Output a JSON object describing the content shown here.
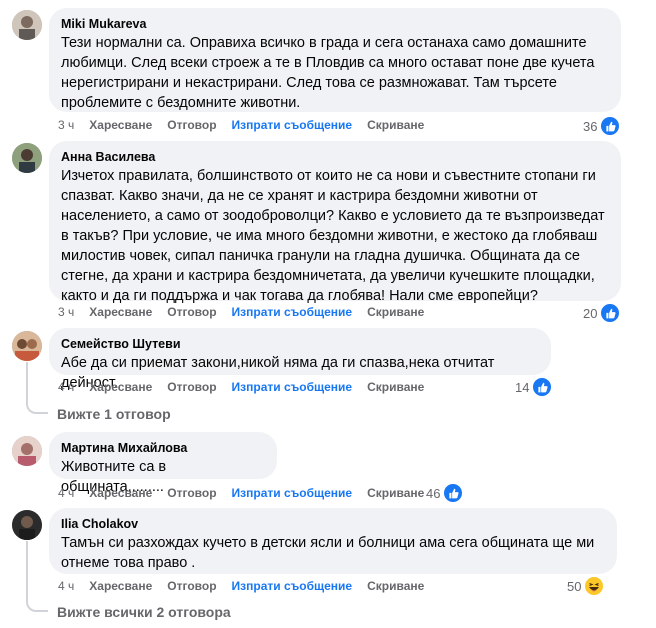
{
  "comments": [
    {
      "author": "Miki Mukareva",
      "text": "Тези нормални са. Оправиха всичко в града и сега останаха само домашните любимци. След всеки строеж а те в Пловдив са много остават поне две кучета нерегистрирани и некастрирани. След това се размножават. Там търсете проблемите с бездомните животни.",
      "time": "3 ч",
      "like": "Харесване",
      "reply": "Отговор",
      "send": "Изпрати съобщение",
      "hide": "Скриване",
      "reactions": "36",
      "reaction_icon": "like-icon"
    },
    {
      "author": "Анна Василева",
      "text": "Изчетох правилата, болшинството от които не са нови и съвестните стопани ги спазват. Какво значи, да не се хранят и кастрира бездомни животни от населението, а само от зоодоброволци? Какво е условието да те възпроизведат в такъв? При условие, че има много бездомни животни, е жестоко да глобяваш милостив човек, сипал паничка гранули на гладна душичка. Общината да се стегне, да храни и кастрира бездомничетата, да увеличи кучешките площадки, както и да ги поддържа и чак тогава да глобява! Нали сме европейци?",
      "time": "3 ч",
      "like": "Харесване",
      "reply": "Отговор",
      "send": "Изпрати съобщение",
      "hide": "Скриване",
      "reactions": "20",
      "reaction_icon": "like-icon"
    },
    {
      "author": "Семейство Шутеви",
      "text": "Абе да си приемат закони,никой няма да ги спазва,нека отчитат дейност.",
      "time": "4 ч",
      "like": "Харесване",
      "reply": "Отговор",
      "send": "Изпрати съобщение",
      "hide": "Скриване",
      "reactions": "14",
      "reaction_icon": "like-icon",
      "view_replies": "Вижте 1 отговор"
    },
    {
      "author": "Мартина Михайлова",
      "text": "Животните са в общината.........",
      "time": "4 ч",
      "like": "Харесване",
      "reply": "Отговор",
      "send": "Изпрати съобщение",
      "hide": "Скриване",
      "reactions": "46",
      "reaction_icon": "like-icon"
    },
    {
      "author": "Ilia Cholakov",
      "text": "Тамън си разхождах кучето в детски ясли и болници ама сега общината ще ми отнеме това право .",
      "time": "4 ч",
      "like": "Харесване",
      "reply": "Отговор",
      "send": "Изпрати съобщение",
      "hide": "Скриване",
      "reactions": "50",
      "reaction_icon": "haha-icon",
      "view_replies": "Вижте всички 2 отговора"
    }
  ],
  "colors": {
    "bubble": "#f0f2f5",
    "link": "#1877f2",
    "muted": "#65676b",
    "like": "#1877f2",
    "haha": "#fcc728"
  }
}
